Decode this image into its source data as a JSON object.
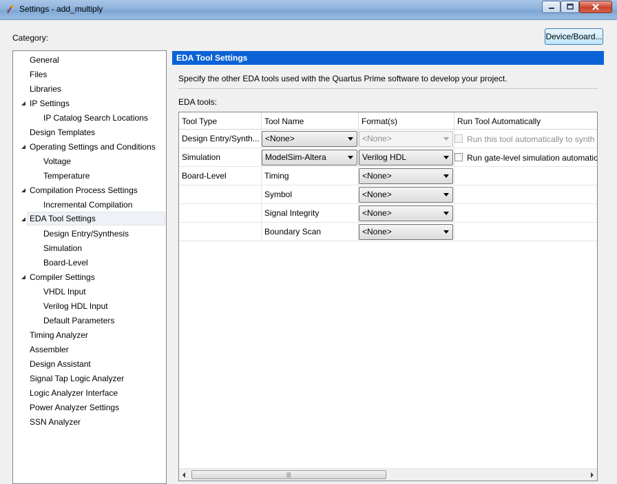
{
  "window": {
    "title": "Settings - add_multiply"
  },
  "header": {
    "category_label": "Category:",
    "device_button": "Device/Board..."
  },
  "tree": {
    "items": [
      {
        "label": "General"
      },
      {
        "label": "Files"
      },
      {
        "label": "Libraries"
      },
      {
        "label": "IP Settings",
        "expanded": true
      },
      {
        "label": "IP Catalog Search Locations"
      },
      {
        "label": "Design Templates"
      },
      {
        "label": "Operating Settings and Conditions",
        "expanded": true
      },
      {
        "label": "Voltage"
      },
      {
        "label": "Temperature"
      },
      {
        "label": "Compilation Process Settings",
        "expanded": true
      },
      {
        "label": "Incremental Compilation"
      },
      {
        "label": "EDA Tool Settings",
        "expanded": true,
        "selected": true
      },
      {
        "label": "Design Entry/Synthesis"
      },
      {
        "label": "Simulation"
      },
      {
        "label": "Board-Level"
      },
      {
        "label": "Compiler Settings",
        "expanded": true
      },
      {
        "label": "VHDL Input"
      },
      {
        "label": "Verilog HDL Input"
      },
      {
        "label": "Default Parameters"
      },
      {
        "label": "Timing Analyzer"
      },
      {
        "label": "Assembler"
      },
      {
        "label": "Design Assistant"
      },
      {
        "label": "Signal Tap Logic Analyzer"
      },
      {
        "label": "Logic Analyzer Interface"
      },
      {
        "label": "Power Analyzer Settings"
      },
      {
        "label": "SSN Analyzer"
      }
    ]
  },
  "panel": {
    "title": "EDA Tool Settings",
    "description": "Specify the other EDA tools used with the Quartus Prime software to develop your project.",
    "eda_tools_label": "EDA tools:",
    "columns": [
      "Tool Type",
      "Tool Name",
      "Format(s)",
      "Run Tool Automatically"
    ],
    "rows": [
      {
        "tool_type": "Design Entry/Synth...",
        "tool_name": "<None>",
        "format": "<None>",
        "format_disabled": true,
        "run_label": "Run this tool automatically to synth",
        "run_disabled": true
      },
      {
        "tool_type": "Simulation",
        "tool_name": "ModelSim-Altera",
        "format": "Verilog HDL",
        "format_disabled": false,
        "run_label": "Run gate-level simulation automatic",
        "run_disabled": false
      },
      {
        "tool_type": "Board-Level",
        "tool_name": "Timing",
        "format": "<None>"
      },
      {
        "tool_type": "",
        "tool_name": "Symbol",
        "format": "<None>"
      },
      {
        "tool_type": "",
        "tool_name": "Signal Integrity",
        "format": "<None>"
      },
      {
        "tool_type": "",
        "tool_name": "Boundary Scan",
        "format": "<None>"
      }
    ],
    "scrollbar_grip": "|||"
  },
  "colors": {
    "header_bg": "#0b62d6",
    "selection_bg": "#eef2f6"
  }
}
